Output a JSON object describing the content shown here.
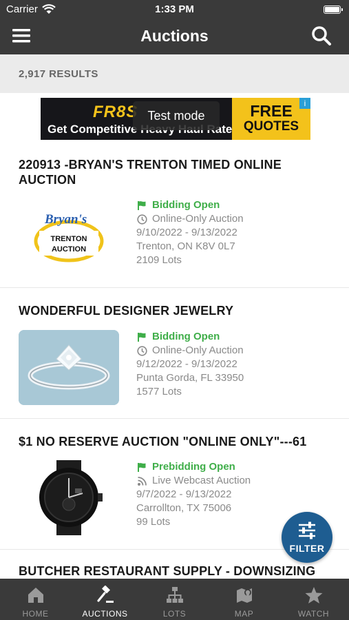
{
  "status_bar": {
    "carrier": "Carrier",
    "time": "1:33 PM"
  },
  "nav": {
    "title": "Auctions",
    "menu_icon": "hamburger-icon",
    "search_icon": "search-icon"
  },
  "results": {
    "count": "2,917 RESULTS"
  },
  "ad": {
    "logo": "FR8S",
    "tagline": "Get Competitive Heavy Haul Rates",
    "cta_line1": "FREE",
    "cta_line2": "QUOTES",
    "overlay": "Test mode",
    "info_icon": "i"
  },
  "auctions": [
    {
      "title": "220913 -BRYAN'S TRENTON TIMED ONLINE AUCTION",
      "image": {
        "logo_text": "Bryan's",
        "line1": "TRENTON",
        "line2": "AUCTION"
      },
      "status": "Bidding Open",
      "status_icon": "flag-icon",
      "type": "Online-Only Auction",
      "type_icon": "clock-icon",
      "dates": "9/10/2022 - 9/13/2022",
      "location": "Trenton, ON K8V 0L7",
      "lots": "2109 Lots"
    },
    {
      "title": "WONDERFUL DESIGNER JEWELRY",
      "image": "diamond-ring",
      "status": "Bidding Open",
      "status_icon": "flag-icon",
      "type": "Online-Only Auction",
      "type_icon": "clock-icon",
      "dates": "9/12/2022 - 9/13/2022",
      "location": "Punta Gorda, FL 33950",
      "lots": "1577 Lots"
    },
    {
      "title": "$1 NO RESERVE AUCTION \"ONLINE ONLY\"---61",
      "image": "black-watch",
      "status": "Prebidding Open",
      "status_icon": "flag-icon",
      "type": "Live Webcast Auction",
      "type_icon": "rss-icon",
      "dates": "9/7/2022 - 9/13/2022",
      "location": "Carrollton, TX 75006",
      "lots": "99 Lots"
    },
    {
      "title": "BUTCHER RESTAURANT SUPPLY - DOWNSIZING"
    }
  ],
  "filter_fab": {
    "label": "FILTER",
    "icon": "sliders-icon"
  },
  "tabs": [
    {
      "label": "HOME",
      "icon": "home-icon",
      "active": false
    },
    {
      "label": "AUCTIONS",
      "icon": "gavel-icon",
      "active": true
    },
    {
      "label": "LOTS",
      "icon": "sitemap-icon",
      "active": false
    },
    {
      "label": "MAP",
      "icon": "map-icon",
      "active": false
    },
    {
      "label": "WATCH",
      "icon": "star-icon",
      "active": false
    }
  ],
  "colors": {
    "bar_background": "#3a3a3a",
    "status_green": "#3fae49",
    "fab_blue": "#1e5d91",
    "results_background": "#ebebeb",
    "ad_yellow": "#f3c21b"
  }
}
